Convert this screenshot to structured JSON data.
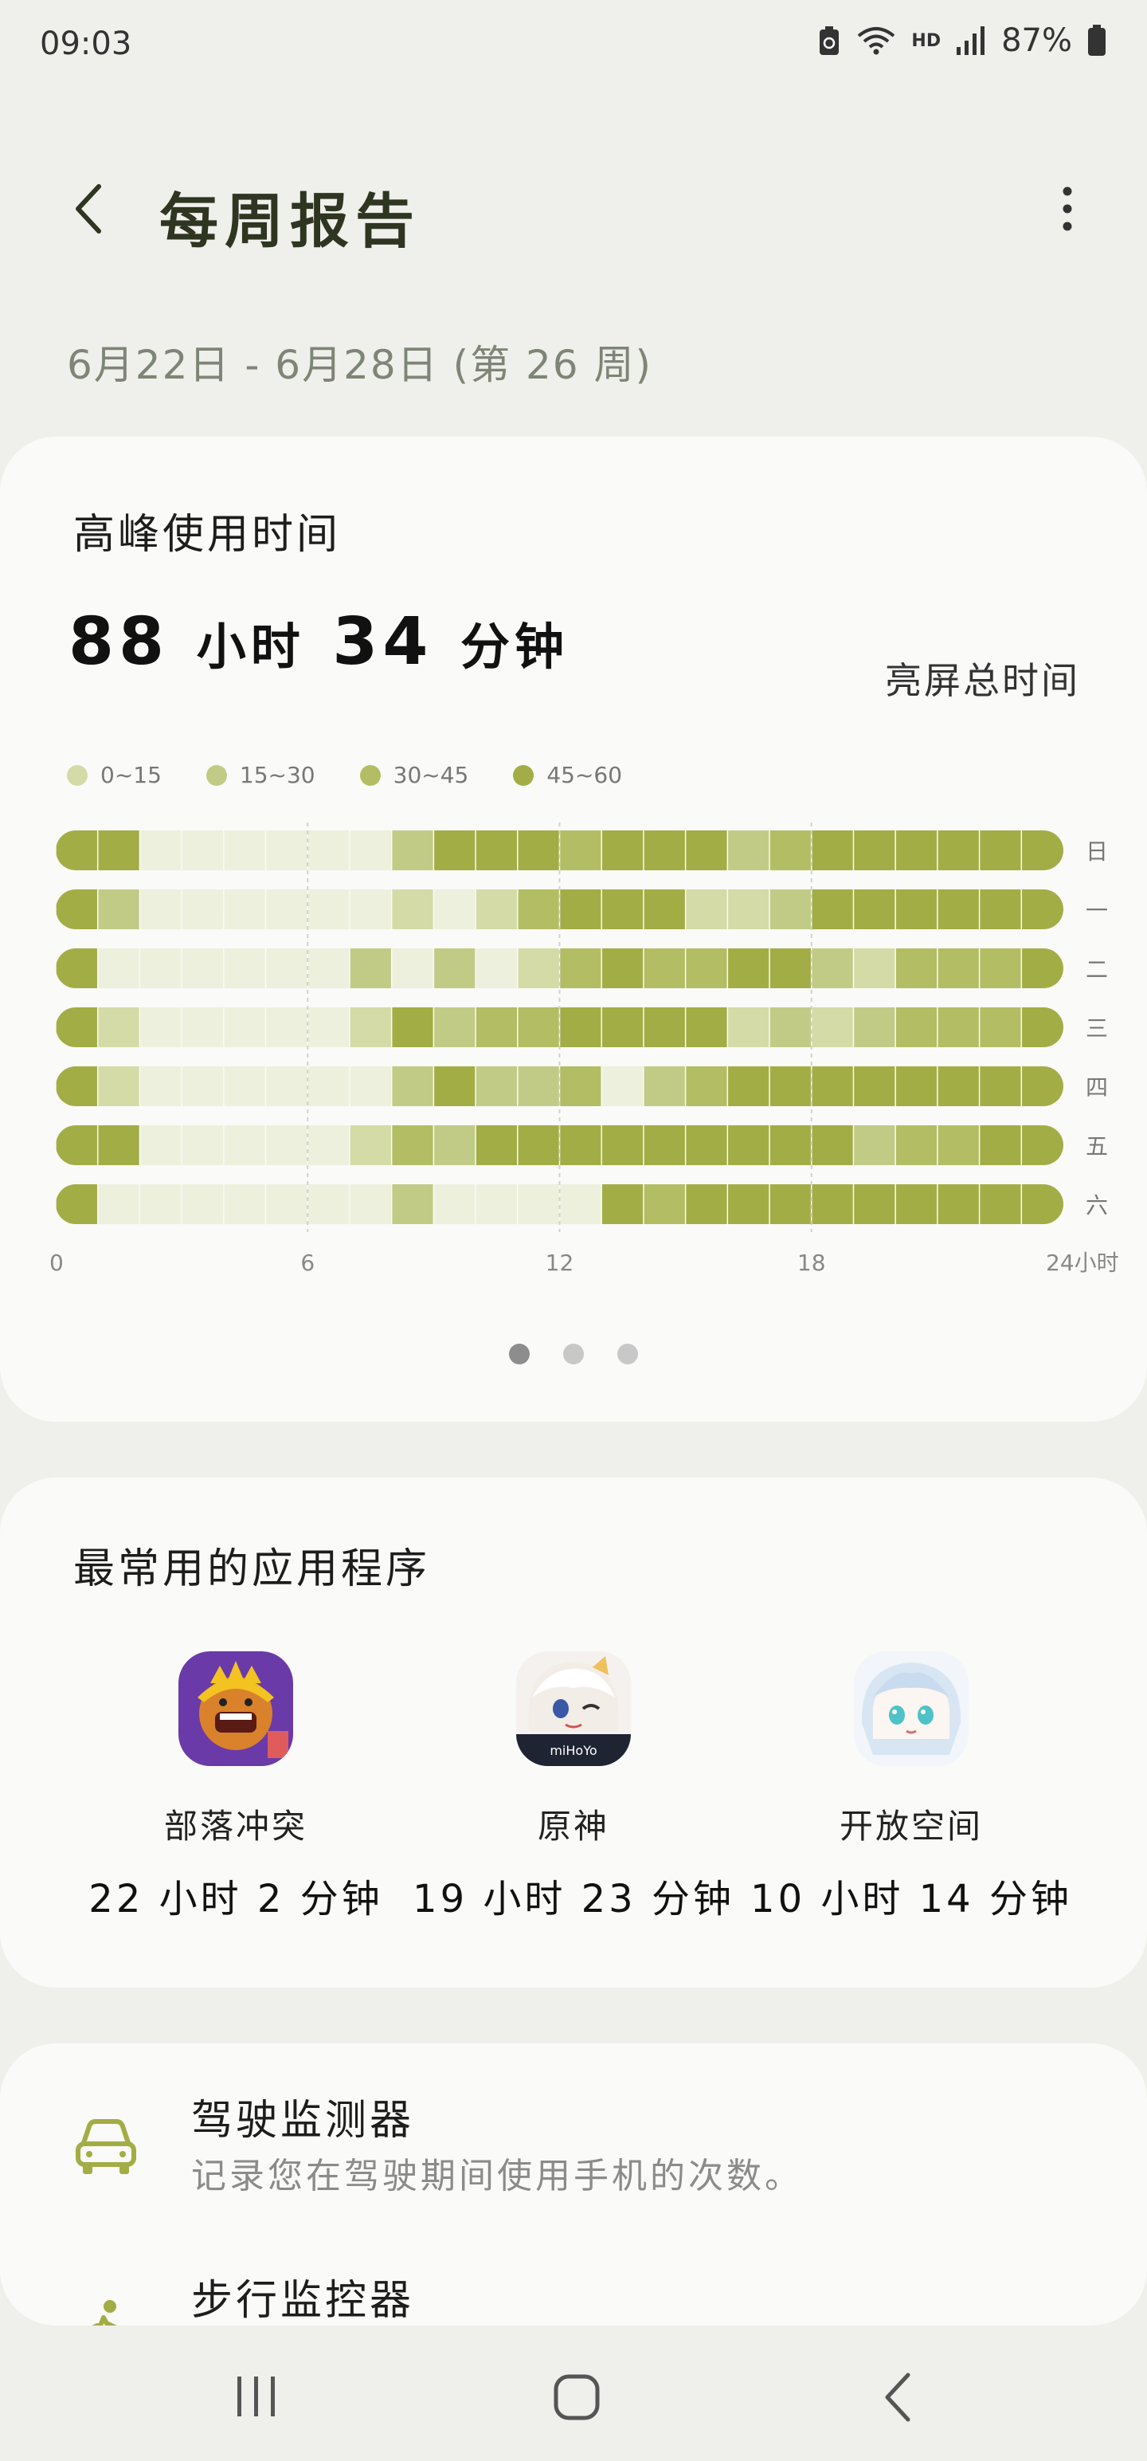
{
  "status_bar": {
    "time": "09:03",
    "network": "HD",
    "battery": "87%",
    "icons": [
      "battery-saver-icon",
      "wifi-icon",
      "signal-icon",
      "battery-icon"
    ]
  },
  "header": {
    "title": "每周报告",
    "back_icon": "back-arrow-icon",
    "more_icon": "more-options-icon"
  },
  "date_range": "6月22日 - 6月28日 (第 26 周)",
  "peak_card": {
    "title": "高峰使用时间",
    "total_hours": "88",
    "hours_unit": "小时",
    "total_minutes": "34",
    "minutes_unit": "分钟",
    "total_label": "亮屏总时间",
    "legend": [
      {
        "label": "0~15",
        "color": "#d4dba6"
      },
      {
        "label": "15~30",
        "color": "#c2cb86"
      },
      {
        "label": "30~45",
        "color": "#b3bd63"
      },
      {
        "label": "45~60",
        "color": "#a3ad45"
      }
    ],
    "page_indicator": {
      "count": 3,
      "active": 0
    }
  },
  "chart_data": {
    "type": "heatmap",
    "x_unit": "小时",
    "x_ticks": [
      "0",
      "6",
      "12",
      "18",
      "24小时"
    ],
    "row_labels": [
      "日",
      "一",
      "二",
      "三",
      "四",
      "五",
      "六"
    ],
    "legend": [
      "0~15",
      "15~30",
      "30~45",
      "45~60"
    ],
    "color_scale": [
      "#edf0dc",
      "#d4dba6",
      "#c2cb86",
      "#b3bd63",
      "#a3ad45"
    ],
    "levels_note": "level 0 = no use, 1 = 0~15, 2 = 15~30, 3 = 30~45, 4 = 45~60 minutes per hour",
    "rows": [
      {
        "day": "日",
        "levels": [
          4,
          4,
          0,
          0,
          0,
          0,
          0,
          0,
          2,
          4,
          4,
          4,
          3,
          4,
          4,
          4,
          2,
          3,
          4,
          4,
          4,
          4,
          4,
          4
        ]
      },
      {
        "day": "一",
        "levels": [
          4,
          2,
          0,
          0,
          0,
          0,
          0,
          0,
          1,
          0,
          1,
          3,
          4,
          4,
          4,
          1,
          1,
          2,
          4,
          4,
          4,
          4,
          4,
          4
        ]
      },
      {
        "day": "二",
        "levels": [
          4,
          0,
          0,
          0,
          0,
          0,
          0,
          2,
          0,
          2,
          0,
          1,
          3,
          4,
          3,
          3,
          4,
          4,
          2,
          1,
          3,
          3,
          3,
          4
        ]
      },
      {
        "day": "三",
        "levels": [
          4,
          1,
          0,
          0,
          0,
          0,
          0,
          1,
          4,
          2,
          3,
          3,
          4,
          4,
          4,
          4,
          1,
          2,
          1,
          2,
          3,
          3,
          3,
          4
        ]
      },
      {
        "day": "四",
        "levels": [
          4,
          1,
          0,
          0,
          0,
          0,
          0,
          0,
          2,
          4,
          2,
          2,
          3,
          0,
          2,
          3,
          4,
          4,
          4,
          4,
          4,
          4,
          4,
          4
        ]
      },
      {
        "day": "五",
        "levels": [
          4,
          4,
          0,
          0,
          0,
          0,
          0,
          1,
          3,
          2,
          4,
          4,
          4,
          4,
          4,
          4,
          4,
          4,
          4,
          2,
          3,
          3,
          4,
          4
        ]
      },
      {
        "day": "六",
        "levels": [
          4,
          0,
          0,
          0,
          0,
          0,
          0,
          0,
          2,
          0,
          0,
          0,
          0,
          4,
          3,
          4,
          4,
          4,
          4,
          4,
          4,
          4,
          4,
          4
        ]
      }
    ]
  },
  "top_apps": {
    "title": "最常用的应用程序",
    "apps": [
      {
        "name": "部落冲突",
        "time": "22 小时 2 分钟",
        "icon": "clash-of-clans-icon"
      },
      {
        "name": "原神",
        "time": "19 小时 23 分钟",
        "icon": "genshin-impact-icon"
      },
      {
        "name": "开放空间",
        "time": "10 小时 14 分钟",
        "icon": "open-space-icon"
      }
    ]
  },
  "features": [
    {
      "title": "驾驶监测器",
      "subtitle": "记录您在驾驶期间使用手机的次数。",
      "icon": "car-icon"
    },
    {
      "title": "步行监控器",
      "subtitle": "",
      "icon": "walking-icon"
    }
  ],
  "nav_bar": {
    "icons": [
      "recents-icon",
      "home-icon",
      "back-icon"
    ]
  }
}
